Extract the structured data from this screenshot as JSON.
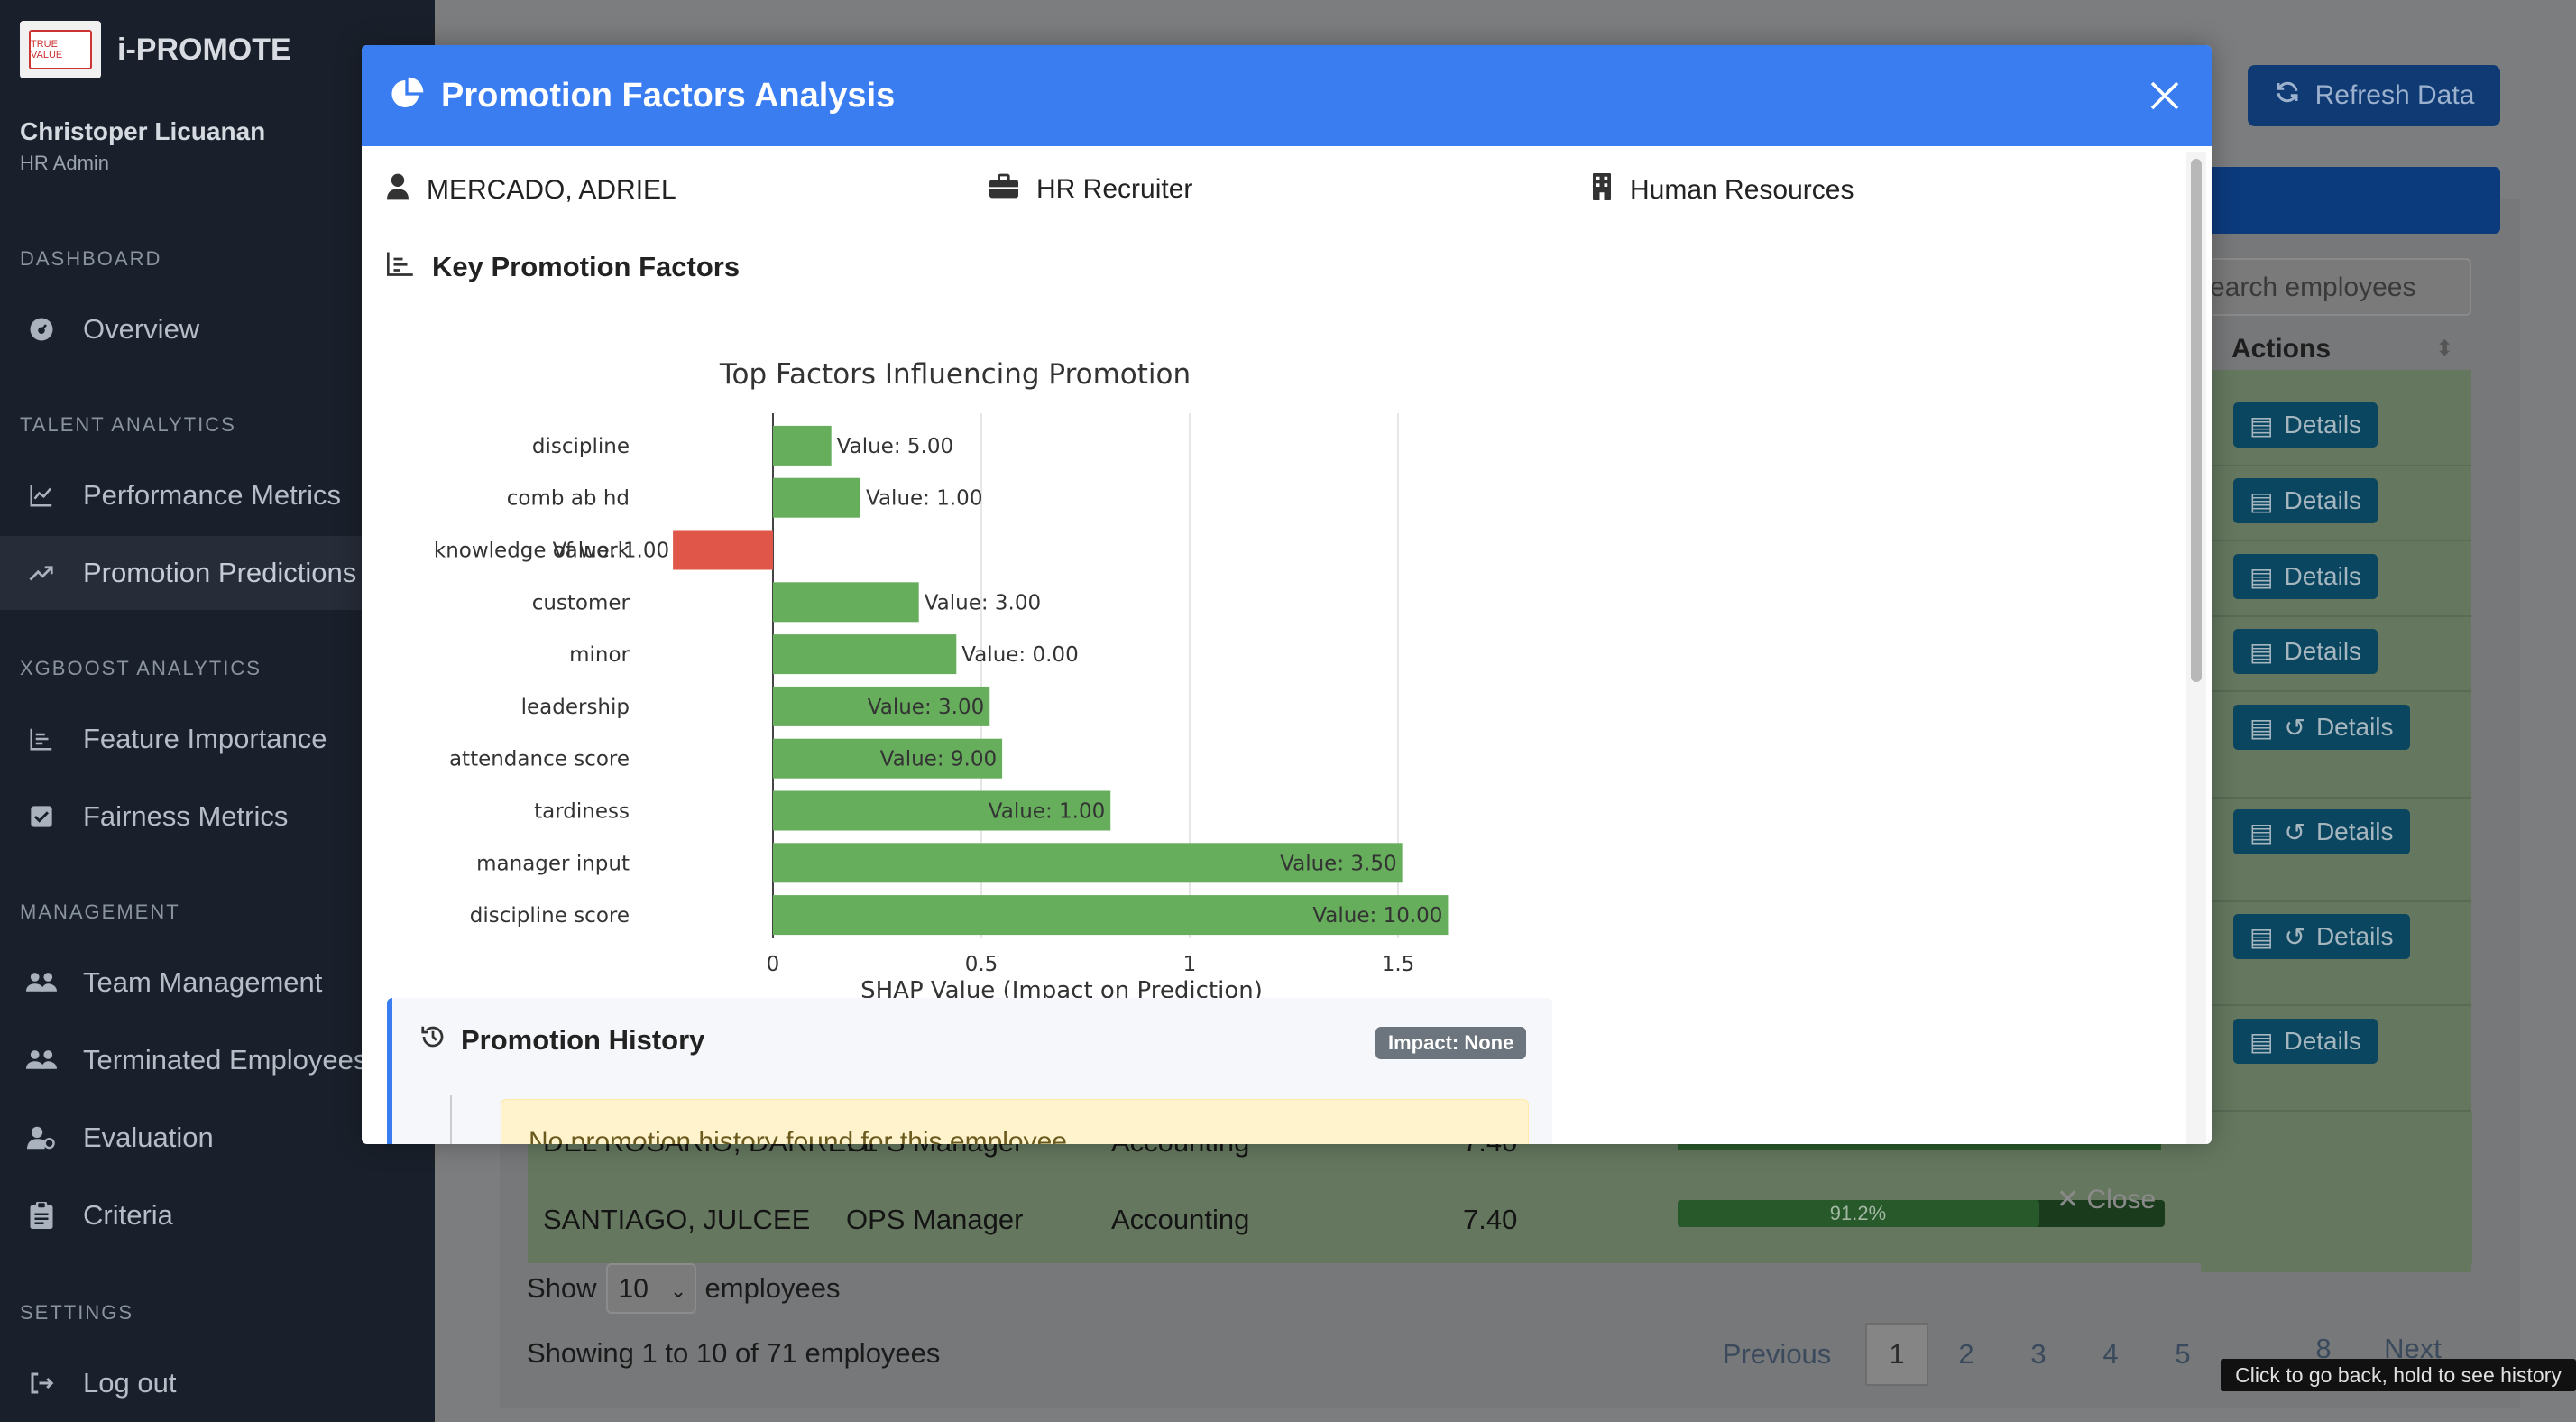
{
  "app": {
    "brand": "i-PROMOTE",
    "logo_text": "TRUE VALUE"
  },
  "user": {
    "name": "Christoper Licuanan",
    "role": "HR Admin"
  },
  "sidebar": {
    "sections": [
      "DASHBOARD",
      "TALENT ANALYTICS",
      "XGBOOST ANALYTICS",
      "MANAGEMENT",
      "SETTINGS"
    ],
    "items": [
      {
        "label": "Overview",
        "icon": "dashboard-icon"
      },
      {
        "label": "Performance Metrics",
        "icon": "line-chart-icon"
      },
      {
        "label": "Promotion Predictions",
        "icon": "trend-up-icon",
        "active": true
      },
      {
        "label": "Feature Importance",
        "icon": "bar-chart-icon"
      },
      {
        "label": "Fairness Metrics",
        "icon": "checkbox-icon"
      },
      {
        "label": "Team Management",
        "icon": "users-icon"
      },
      {
        "label": "Terminated Employees",
        "icon": "users-icon"
      },
      {
        "label": "Evaluation",
        "icon": "user-cog-icon"
      },
      {
        "label": "Criteria",
        "icon": "clipboard-icon"
      },
      {
        "label": "Log out",
        "icon": "logout-icon"
      }
    ]
  },
  "background": {
    "refresh_label": "Refresh Data",
    "search_placeholder": "earch employees",
    "actions_header": "Actions",
    "details_label": "Details",
    "rows": [
      {
        "name": "DEL ROSARIO, DARRELL",
        "position": "OPS Manager",
        "department": "Accounting",
        "score": "7.40"
      },
      {
        "name": "SANTIAGO, JULCEE",
        "position": "OPS Manager",
        "department": "Accounting",
        "score": "7.40",
        "probability": "91.2%",
        "probability_value": 0.912
      }
    ],
    "close_label": "✕ Close",
    "show_label": "Show",
    "show_value": "10",
    "employees_label": "employees",
    "showing_text": "Showing 1 to 10 of 71 employees",
    "pagination": [
      "Previous",
      "1",
      "2",
      "3",
      "4",
      "5",
      "8",
      "Next"
    ],
    "tooltip": "Click to go back, hold to see history"
  },
  "modal": {
    "title": "Promotion Factors Analysis",
    "employee_name": "MERCADO, ADRIEL",
    "position": "HR Recruiter",
    "department": "Human Resources",
    "section_title": "Key Promotion Factors",
    "history_title": "Promotion History",
    "impact_badge": "Impact: None",
    "history_message": "No promotion history found for this employee."
  },
  "colors": {
    "modal_header": "#3a7df0",
    "positive_bar": "#66ad5c",
    "negative_bar": "#e0574a"
  },
  "chart_data": {
    "type": "bar",
    "orientation": "horizontal",
    "title": "Top Factors Influencing Promotion",
    "xlabel": "SHAP Value (Impact on Prediction)",
    "ylabel": "",
    "xlim": [
      -0.24,
      1.62
    ],
    "xticks": [
      0,
      0.5,
      1,
      1.5
    ],
    "xtick_labels": [
      "0",
      "0.5",
      "1",
      "1.5"
    ],
    "categories": [
      "discipline",
      "comb ab hd",
      "knowledge of work",
      "customer",
      "minor",
      "leadership",
      "attendance score",
      "tardiness",
      "manager input",
      "discipline score"
    ],
    "values": [
      0.14,
      0.21,
      -0.24,
      0.35,
      0.44,
      0.52,
      0.55,
      0.81,
      1.51,
      1.62
    ],
    "data_labels": [
      "Value: 5.00",
      "Value: 1.00",
      "Value: 1.00",
      "Value: 3.00",
      "Value: 0.00",
      "Value: 3.00",
      "Value: 9.00",
      "Value: 1.00",
      "Value: 3.50",
      "Value: 10.00"
    ],
    "grid": true
  }
}
